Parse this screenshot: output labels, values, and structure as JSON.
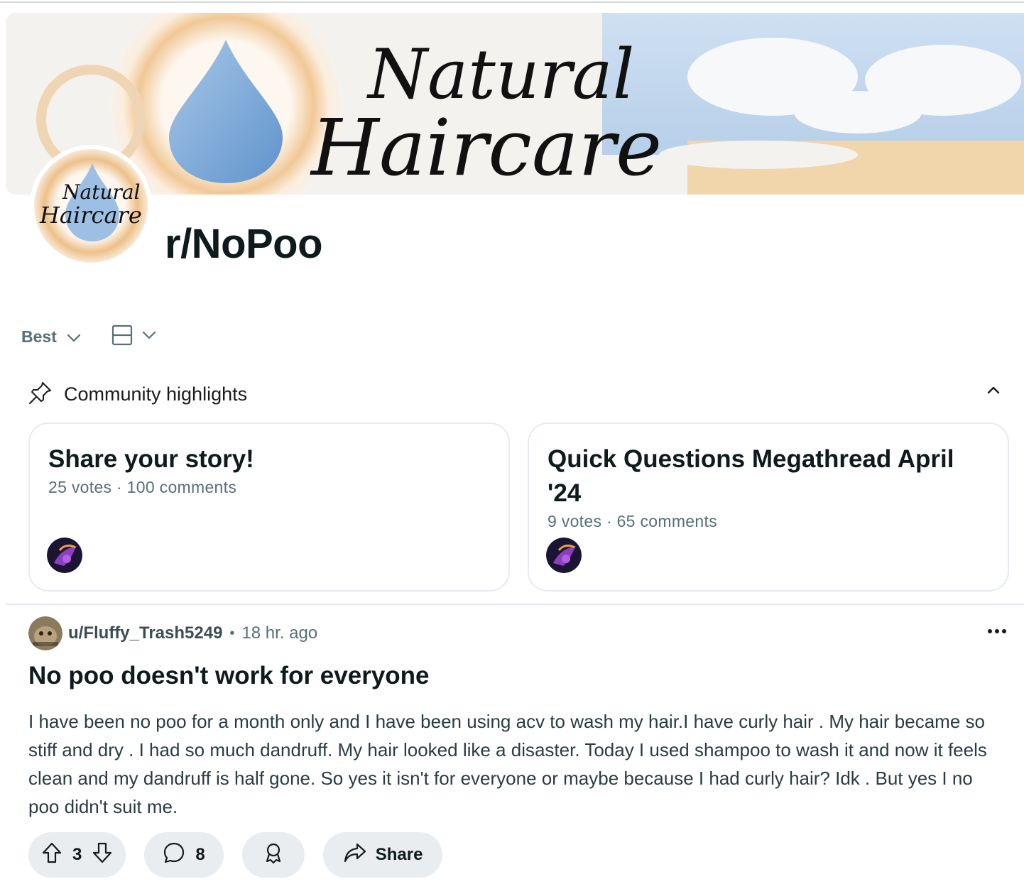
{
  "community": {
    "name": "r/NoPoo",
    "banner_text_line1": "Natural",
    "banner_text_line2": "Haircare"
  },
  "feed_controls": {
    "sort_label": "Best",
    "view_icon": "card-view-icon"
  },
  "highlights": {
    "label": "Community highlights",
    "cards": [
      {
        "title": "Share your story!",
        "meta": "25 votes · 100 comments"
      },
      {
        "title": "Quick Questions Megathread April '24",
        "meta": "9 votes · 65 comments"
      }
    ]
  },
  "post": {
    "username": "u/Fluffy_Trash5249",
    "time": "18 hr. ago",
    "title": "No poo doesn't work for everyone",
    "body": "I have been no poo for a month only and I have been using acv to wash my hair.I have curly hair . My hair became so stiff and dry . I had so much dandruff. My hair looked like a disaster. Today I used shampoo to wash it and now it feels clean and my dandruff is half gone. So yes it isn't for everyone or maybe because I had curly hair? Idk . But yes I no poo didn't suit me.",
    "votes": "3",
    "comments": "8",
    "share_label": "Share"
  },
  "colors": {
    "pill_bg": "#eaedef",
    "meta_text": "#576f76",
    "drop_blue": "#7ea9d6",
    "ring_orange": "#e9b77c"
  }
}
